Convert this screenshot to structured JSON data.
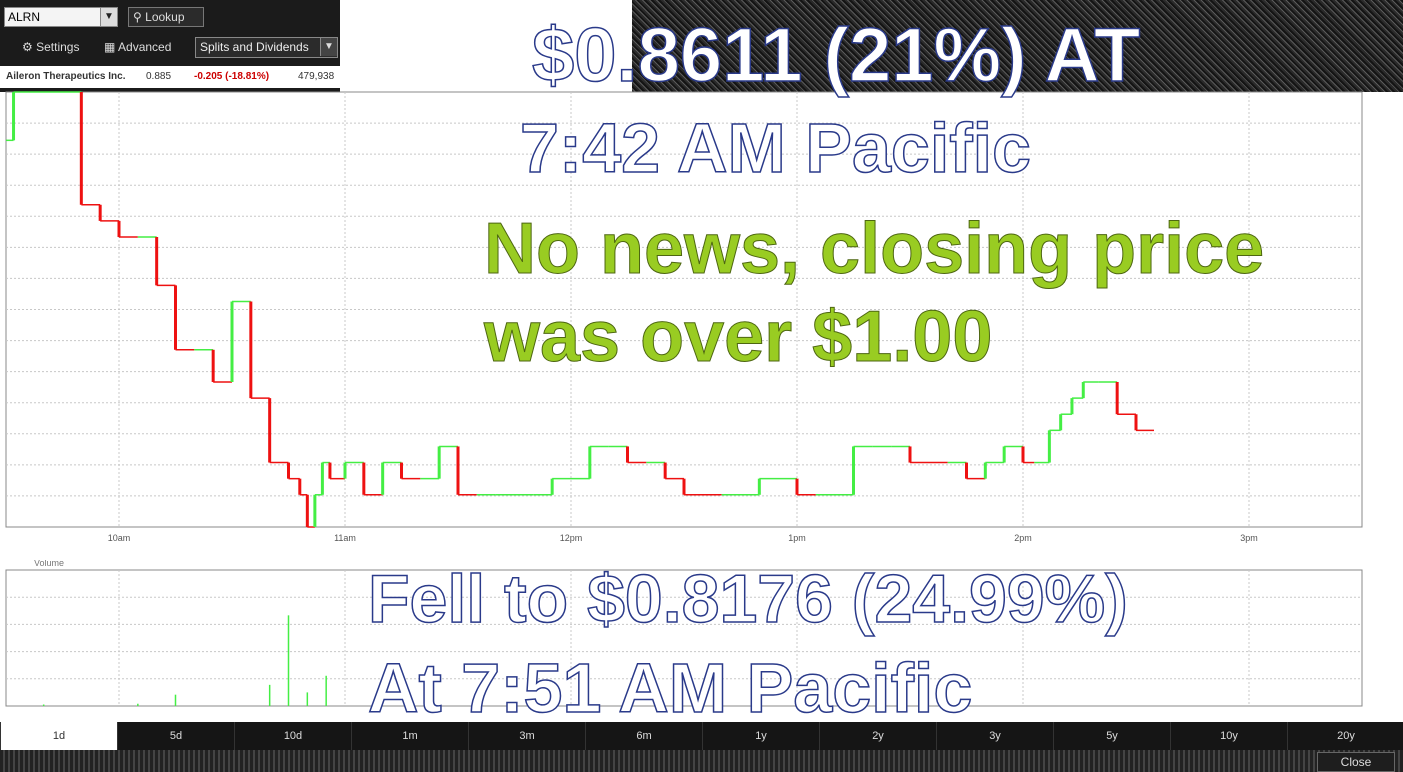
{
  "toolbar": {
    "symbol": "ALRN",
    "lookup_label": "Lookup",
    "settings_label": "Settings",
    "advanced_label": "Advanced",
    "splits_label": "Splits and Dividends"
  },
  "quote": {
    "company": "Aileron Therapeutics Inc.",
    "price": "0.885",
    "change": "-0.205 (-18.81%)",
    "volume": "479,938"
  },
  "colors": {
    "up": "#44ee44",
    "down": "#ee1111",
    "grid": "#c8c8c8",
    "overlay_green": "#99cc22"
  },
  "overlays": {
    "headline1": "$0.8611 (21%) AT",
    "headline2": "7:42 AM Pacific",
    "note1": "No news, closing price",
    "note2": "was over $1.00",
    "fell1": "Fell to $0.8176 (24.99%)",
    "fell2": "At 7:51 AM Pacific"
  },
  "timeframes": [
    "1d",
    "5d",
    "10d",
    "1m",
    "3m",
    "6m",
    "1y",
    "2y",
    "3y",
    "5y",
    "10y",
    "20y"
  ],
  "active_timeframe": "1d",
  "close_label": "Close",
  "chart_data": [
    {
      "type": "line",
      "title": "",
      "xlabel": "",
      "ylabel": "",
      "x_ticks": [
        "10am",
        "11am",
        "12pm",
        "1pm",
        "2pm",
        "3pm"
      ],
      "x_range": [
        "09:30",
        "15:30"
      ],
      "ylim": [
        0.82,
        1.09
      ],
      "grid": true,
      "series": [
        {
          "x": [
            "09:30",
            "09:32",
            "09:34",
            "09:36",
            "09:50",
            "09:55",
            "10:00",
            "10:05",
            "10:10",
            "10:15",
            "10:20",
            "10:25",
            "10:30",
            "10:35",
            "10:40",
            "10:45",
            "10:48",
            "10:50",
            "10:52",
            "10:54",
            "10:56",
            "11:00",
            "11:05",
            "11:10",
            "11:15",
            "11:20",
            "11:25",
            "11:30",
            "11:35",
            "11:40",
            "11:45",
            "11:50",
            "11:55",
            "12:00",
            "12:05",
            "12:10",
            "12:15",
            "12:20",
            "12:25",
            "12:30",
            "12:40",
            "12:50",
            "13:00",
            "13:05",
            "13:15",
            "13:20",
            "13:25",
            "13:30",
            "13:40",
            "13:45",
            "13:50",
            "13:55",
            "14:00",
            "14:03",
            "14:07",
            "14:10",
            "14:13",
            "14:16",
            "14:20",
            "14:25",
            "14:30"
          ],
          "values": [
            1.06,
            1.09,
            1.09,
            1.09,
            1.02,
            1.01,
            1.0,
            1.0,
            0.97,
            0.93,
            0.93,
            0.91,
            0.96,
            0.9,
            0.86,
            0.85,
            0.84,
            0.82,
            0.84,
            0.86,
            0.85,
            0.86,
            0.84,
            0.86,
            0.85,
            0.85,
            0.87,
            0.84,
            0.84,
            0.84,
            0.84,
            0.84,
            0.85,
            0.85,
            0.87,
            0.87,
            0.86,
            0.86,
            0.85,
            0.84,
            0.84,
            0.85,
            0.84,
            0.84,
            0.87,
            0.87,
            0.87,
            0.86,
            0.86,
            0.85,
            0.86,
            0.87,
            0.86,
            0.86,
            0.88,
            0.89,
            0.9,
            0.91,
            0.91,
            0.89,
            0.88
          ]
        }
      ]
    },
    {
      "type": "bar",
      "title": "Volume",
      "values_description": "",
      "x": [
        "09:40",
        "10:05",
        "10:15",
        "10:40",
        "10:45",
        "10:50",
        "10:55"
      ],
      "values": [
        2000,
        3000,
        15000,
        28000,
        120000,
        18000,
        40000
      ],
      "ylim": [
        0,
        180000
      ]
    }
  ]
}
